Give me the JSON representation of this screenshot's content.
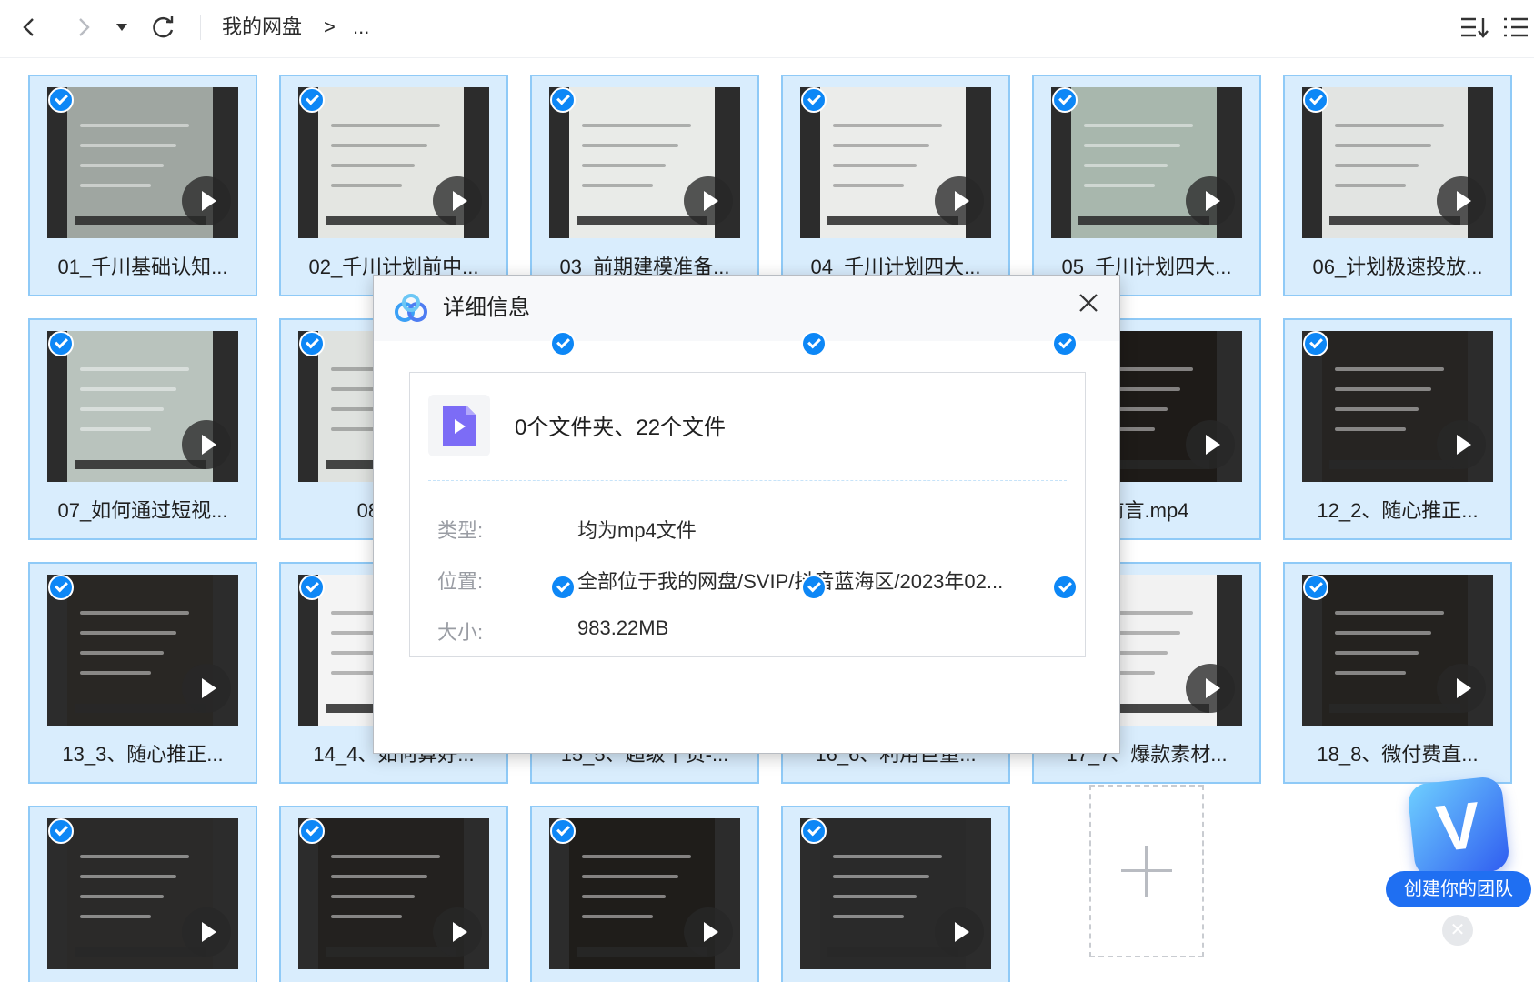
{
  "toolbar": {
    "breadcrumb_root": "我的网盘",
    "breadcrumb_sep": ">",
    "breadcrumb_more": "..."
  },
  "files": [
    {
      "name": "01_千川基础认知...",
      "thumb": "#9fa6a1"
    },
    {
      "name": "02_千川计划前中...",
      "thumb": "#e4e6e2"
    },
    {
      "name": "03_前期建模准备...",
      "thumb": "#e9ebe8"
    },
    {
      "name": "04_千川计划四大...",
      "thumb": "#ebecea"
    },
    {
      "name": "05_千川计划四大...",
      "thumb": "#a8b7ad"
    },
    {
      "name": "06_计划极速投放...",
      "thumb": "#e2e4e2"
    },
    {
      "name": "07_如何通过短视...",
      "thumb": "#b9c3bd"
    },
    {
      "name": "08_千川",
      "thumb": "#dfe2df"
    },
    {
      "name": "",
      "thumb": "#3a3a3a"
    },
    {
      "name": "",
      "thumb": "#2c2c2c"
    },
    {
      "name": "前言.mp4",
      "thumb": "#1e1b18"
    },
    {
      "name": "12_2、随心推正...",
      "thumb": "#262422"
    },
    {
      "name": "13_3、随心推正...",
      "thumb": "#292724"
    },
    {
      "name": "14_4、如何算好...",
      "thumb": "#f4f4f4"
    },
    {
      "name": "15_5、超级干货-...",
      "thumb": "#2a2a2a"
    },
    {
      "name": "16_6、利用巨量...",
      "thumb": "#2a2a2a"
    },
    {
      "name": "17_7、爆款素材...",
      "thumb": "#f2f2f2"
    },
    {
      "name": "18_8、微付费直...",
      "thumb": "#24221f"
    },
    {
      "name": "",
      "thumb": "#2b2a29"
    },
    {
      "name": "",
      "thumb": "#23211f"
    },
    {
      "name": "",
      "thumb": "#1f1d1a"
    },
    {
      "name": "",
      "thumb": "#2a2a2a"
    }
  ],
  "dialog": {
    "title": "详细信息",
    "summary": "0个文件夹、22个文件",
    "type_label": "类型:",
    "type_value": "均为mp4文件",
    "location_label": "位置:",
    "location_value": "全部位于我的网盘/SVIP/抖音蓝海区/2023年02...",
    "size_label": "大小:",
    "size_value": "983.22MB"
  },
  "promo": {
    "label": "创建你的团队",
    "badge": "V"
  },
  "colors": {
    "accent": "#0d87f6",
    "selected_tile_bg": "#d9edfd",
    "selected_tile_border": "#8fcaf7",
    "video_icon": "#7c6cf6"
  }
}
